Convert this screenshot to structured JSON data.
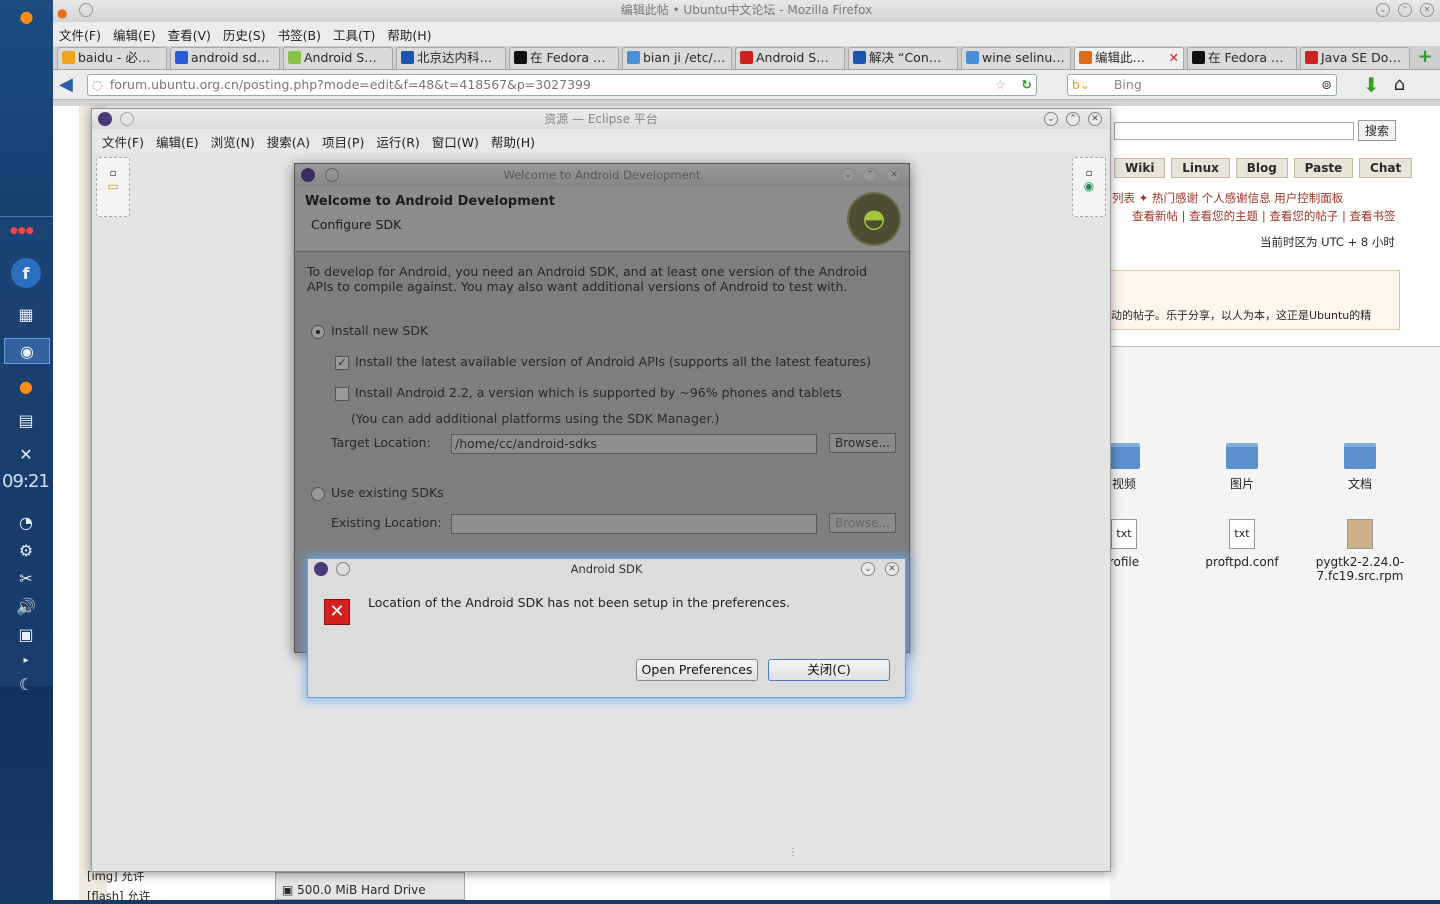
{
  "firefox": {
    "title": "编辑此帖 • Ubuntu中文论坛 - Mozilla Firefox",
    "menu": [
      "文件(F)",
      "编辑(E)",
      "查看(V)",
      "历史(S)",
      "书签(B)",
      "工具(T)",
      "帮助(H)"
    ],
    "tabs": [
      {
        "label": "baidu - 必…",
        "color": "#f2a31c"
      },
      {
        "label": "android sd…",
        "color": "#2a5bd7"
      },
      {
        "label": "Android S…",
        "color": "#8bc34a"
      },
      {
        "label": "北京达内科…",
        "color": "#1a56b0"
      },
      {
        "label": "在 Fedora …",
        "color": "#111111"
      },
      {
        "label": "bian ji /etc/…",
        "color": "#4a90d9"
      },
      {
        "label": "Android S…",
        "color": "#cc2222"
      },
      {
        "label": "解决 “Con…",
        "color": "#1a56b0"
      },
      {
        "label": "wine selinu…",
        "color": "#4a90d9"
      },
      {
        "label": "编辑此…",
        "color": "#e06a1a"
      },
      {
        "label": "在 Fedora …",
        "color": "#111111"
      },
      {
        "label": "Java SE Do…",
        "color": "#cc2222"
      }
    ],
    "url": "forum.ubuntu.org.cn/posting.php?mode=edit&f=48&t=418567&p=3027399",
    "search_placeholder": "Bing"
  },
  "dock": {
    "clock": "09:21"
  },
  "forum": {
    "search_button": "搜索",
    "nav_tabs": [
      "Wiki",
      "Linux",
      "Blog",
      "Paste",
      "Chat"
    ],
    "links_row1": "列表  ✦ 热门感谢  个人感谢信息  用户控制面板",
    "links_row2": "查看新帖 | 查看您的主题 | 查看您的帖子 | 查看书签",
    "timezone": "当前时区为 UTC + 8 小时",
    "slogan": "动的帖子。乐于分享，以人为本，这正是Ubuntu的精",
    "bottom_items": [
      "[img] 允许",
      "[flash] 允许",
      "500.0 MiB Hard Drive"
    ]
  },
  "files": [
    {
      "label": "视频",
      "type": "folder"
    },
    {
      "label": "图片",
      "type": "folder"
    },
    {
      "label": "文档",
      "type": "folder"
    },
    {
      "label": "rofile",
      "type": "txt"
    },
    {
      "label": "proftpd.conf",
      "type": "txt"
    },
    {
      "label": "pygtk2-2.24.0-7.fc19.src.rpm",
      "type": "pkg"
    }
  ],
  "eclipse": {
    "title": "资源 — Eclipse 平台",
    "menu": [
      "文件(F)",
      "编辑(E)",
      "浏览(N)",
      "搜索(A)",
      "项目(P)",
      "运行(R)",
      "窗口(W)",
      "帮助(H)"
    ]
  },
  "welcome": {
    "window_title": "Welcome to Android Development",
    "heading": "Welcome to Android Development",
    "subheading": "Configure SDK",
    "intro": "To develop for Android, you need an Android SDK, and at least one version of the Android APIs to compile against. You may also want additional versions of Android to test with.",
    "install_new": "Install new SDK",
    "opt_latest": "Install the latest available version of Android APIs (supports all the latest features)",
    "opt_22": "Install Android 2.2, a version which is supported by ~96% phones and tablets",
    "note": "(You can add additional platforms using the SDK Manager.)",
    "target_label": "Target Location:",
    "target_value": "/home/cc/android-sdks",
    "browse": "Browse...",
    "use_existing": "Use existing SDKs",
    "existing_label": "Existing Location:",
    "existing_value": ""
  },
  "alert": {
    "title": "Android SDK",
    "message": "Location of the Android SDK has not been setup in the preferences.",
    "btn_prefs": "Open Preferences",
    "btn_close": "关闭(C)"
  }
}
